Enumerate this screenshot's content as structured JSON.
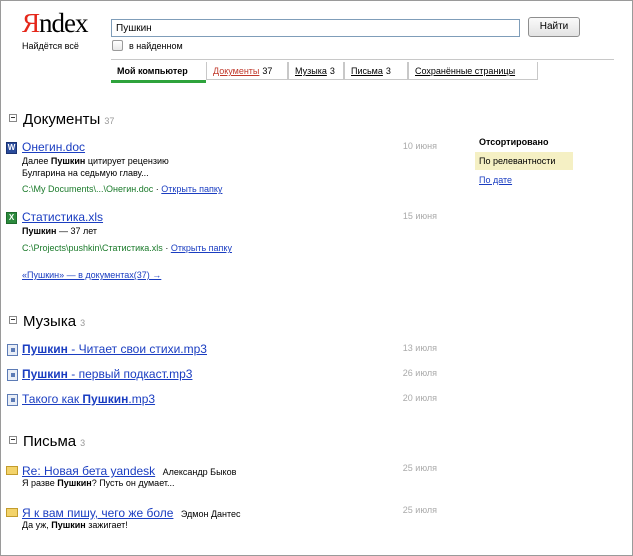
{
  "logo": {
    "ya": "Я",
    "ndex": "ndex",
    "tagline": "Найдётся всё"
  },
  "search": {
    "query": "Пушкин",
    "button_label": "Найти",
    "within_label": "в найденном"
  },
  "tabs": [
    {
      "label": "Мой компьютер",
      "count": ""
    },
    {
      "label": "Документы",
      "count": "37"
    },
    {
      "label": "Музыка",
      "count": "3"
    },
    {
      "label": "Письма",
      "count": "3"
    },
    {
      "label": "Сохранённые страницы",
      "count": ""
    }
  ],
  "sort": {
    "title": "Отсортировано",
    "by_relevance": "По релевантности",
    "by_date": "По дате"
  },
  "documents": {
    "title": "Документы",
    "count": "37",
    "items": [
      {
        "title": "Онегин.doc",
        "date": "10 июня",
        "snippet_pre": "Далее ",
        "snippet_bold": "Пушкин",
        "snippet_post": " цитирует рецензию",
        "snippet_line2": "Булгарина на седьмую главу...",
        "path": "C:\\My Documents\\...\\Онегин.doc",
        "sep": " · ",
        "open": "Открыть папку",
        "icon": "word-doc-icon"
      },
      {
        "title": "Статистика.xls",
        "date": "15 июня",
        "snippet_bold": "Пушкин",
        "snippet_post": " — 37 лет",
        "path": "C:\\Projects\\pushkin\\Статистика.xls",
        "sep": " · ",
        "open": "Открыть папку",
        "icon": "excel-icon"
      }
    ],
    "more": "«Пушкин» — в документах(37) →"
  },
  "music": {
    "title": "Музыка",
    "count": "3",
    "items": [
      {
        "bold": "Пушкин",
        "rest": " - Читает свои стихи.mp3",
        "date": "13 июля"
      },
      {
        "bold": "Пушкин",
        "rest": " - первый подкаст.mp3",
        "date": "26 июля"
      },
      {
        "pre": "Такого как ",
        "bold": "Пушкин",
        "rest": ".mp3",
        "date": "20 июля"
      }
    ]
  },
  "mail": {
    "title": "Письма",
    "count": "3",
    "items": [
      {
        "subject": "Re: Новая бета yandesk",
        "from": "Александр Быков",
        "date": "25 июля",
        "snip_pre": "Я разве ",
        "snip_bold": "Пушкин",
        "snip_post": "? Пусть он думает..."
      },
      {
        "subject": "Я к вам пишу, чего же боле",
        "from": "Эдмон Дантес",
        "date": "25 июля",
        "snip_pre": "Да уж, ",
        "snip_bold": "Пушкин",
        "snip_post": " зажигает!"
      }
    ]
  },
  "colors": {
    "link": "#1a3dc1",
    "active_tab": "#2ea33c",
    "path": "#1a7a2a",
    "logo_red": "#e5271a"
  }
}
